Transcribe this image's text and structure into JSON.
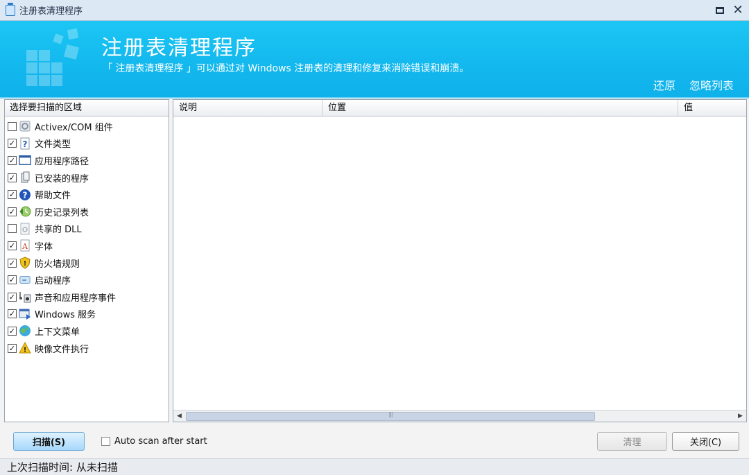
{
  "window": {
    "title": "注册表清理程序",
    "icon": "recycle-bin-icon"
  },
  "banner": {
    "heading": "注册表清理程序",
    "description": "「 注册表清理程序 」可以通过对 Windows 注册表的清理和修复来消除错误和崩溃。",
    "restore_link": "还原",
    "ignore_list_link": "忽略列表"
  },
  "scan_areas": {
    "header": "选择要扫描的区域",
    "items": [
      {
        "label": "Activex/COM 组件",
        "checked": false,
        "icon": "activex-icon"
      },
      {
        "label": "文件类型",
        "checked": true,
        "icon": "file-type-icon"
      },
      {
        "label": "应用程序路径",
        "checked": true,
        "icon": "app-path-icon"
      },
      {
        "label": "已安装的程序",
        "checked": true,
        "icon": "installed-programs-icon"
      },
      {
        "label": "帮助文件",
        "checked": true,
        "icon": "help-icon"
      },
      {
        "label": "历史记录列表",
        "checked": true,
        "icon": "history-icon"
      },
      {
        "label": "共享的 DLL",
        "checked": false,
        "icon": "dll-icon"
      },
      {
        "label": "字体",
        "checked": true,
        "icon": "font-icon"
      },
      {
        "label": "防火墙规则",
        "checked": true,
        "icon": "firewall-shield-icon"
      },
      {
        "label": "启动程序",
        "checked": true,
        "icon": "startup-icon"
      },
      {
        "label": "声音和应用程序事件",
        "checked": true,
        "icon": "sound-icon"
      },
      {
        "label": "Windows 服务",
        "checked": true,
        "icon": "service-icon"
      },
      {
        "label": "上下文菜单",
        "checked": true,
        "icon": "context-menu-globe-icon"
      },
      {
        "label": "映像文件执行",
        "checked": true,
        "icon": "warning-icon"
      }
    ]
  },
  "results": {
    "columns": [
      "说明",
      "位置",
      "值"
    ],
    "rows": []
  },
  "controls": {
    "scan_label": "扫描(S)",
    "auto_scan_label": "Auto scan after start",
    "auto_scan_checked": false,
    "clean_label": "清理",
    "close_label": "关闭(C)"
  },
  "status": {
    "text": "上次扫描时间: 从未扫描"
  },
  "colors": {
    "banner": "#13b8ee",
    "scan_button": "#a7d8fb"
  }
}
